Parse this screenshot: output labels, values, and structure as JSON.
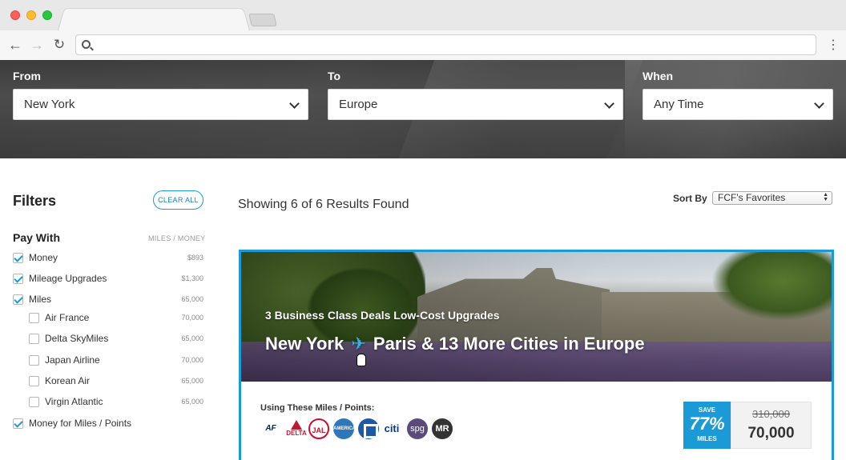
{
  "search": {
    "from_label": "From",
    "from_value": "New York",
    "to_label": "To",
    "to_value": "Europe",
    "when_label": "When",
    "when_value": "Any Time"
  },
  "filters": {
    "title": "Filters",
    "clear_all": "CLEAR ALL",
    "pay_with": "Pay With",
    "column_header": "MILES / MONEY",
    "items": [
      {
        "label": "Money",
        "value": "$893",
        "checked": true,
        "indent": false
      },
      {
        "label": "Mileage Upgrades",
        "value": "$1,300",
        "checked": true,
        "indent": false
      },
      {
        "label": "Miles",
        "value": "65,000",
        "checked": true,
        "indent": false
      },
      {
        "label": "Air France",
        "value": "70,000",
        "checked": false,
        "indent": true
      },
      {
        "label": "Delta SkyMiles",
        "value": "65,000",
        "checked": false,
        "indent": true
      },
      {
        "label": "Japan Airline",
        "value": "70,000",
        "checked": false,
        "indent": true
      },
      {
        "label": "Korean Air",
        "value": "65,000",
        "checked": false,
        "indent": true
      },
      {
        "label": "Virgin Atlantic",
        "value": "65,000",
        "checked": false,
        "indent": true
      },
      {
        "label": "Money for Miles / Points",
        "value": "",
        "checked": true,
        "indent": false
      }
    ]
  },
  "results": {
    "count_text": "Showing 6 of 6 Results Found",
    "sort_label": "Sort By",
    "sort_value": "FCF's Favorites"
  },
  "deal": {
    "subtitle": "3 Business Class Deals Low-Cost Upgrades",
    "title_from": "New York",
    "title_to": "Paris & 13 More Cities in Europe",
    "using_label": "Using These Miles / Points:",
    "logos": [
      "AF",
      "DELTA",
      "JAL",
      "AMERICAN EXPRESS",
      "",
      "citi",
      "spg",
      "MR"
    ],
    "save_label": "SAVE",
    "save_percent": "77%",
    "save_unit": "MILES",
    "price_old": "310,000",
    "price_new": "70,000"
  },
  "colors": {
    "accent": "#1a9ad6"
  }
}
